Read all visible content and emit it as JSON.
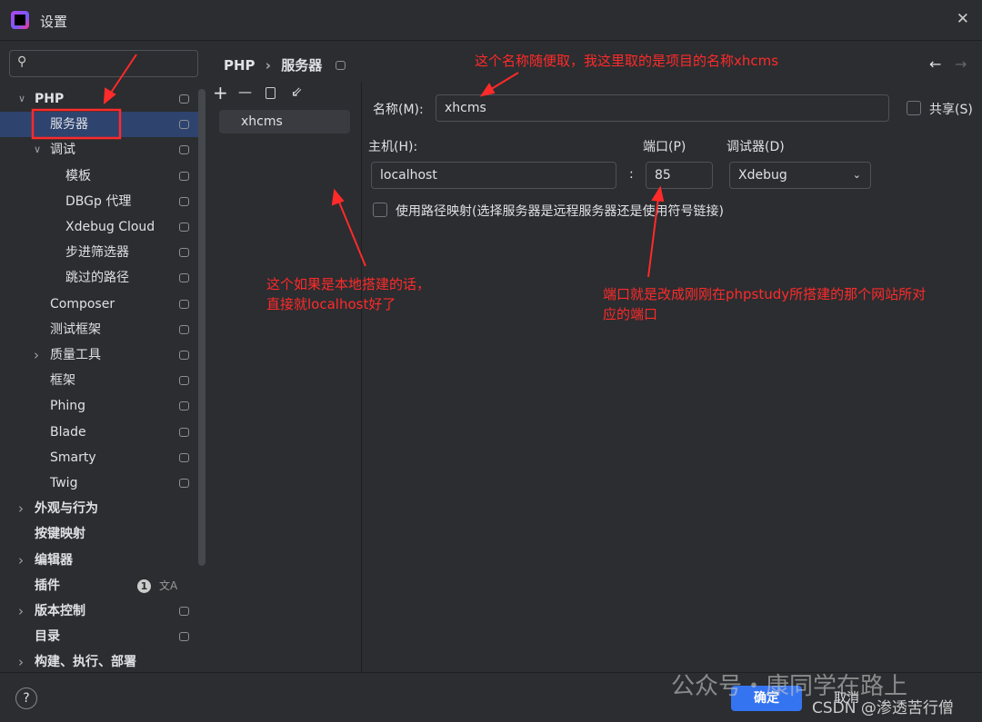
{
  "window": {
    "title": "设置",
    "close": "✕"
  },
  "search": {
    "placeholder": ""
  },
  "breadcrumb": {
    "parent": "PHP",
    "separator": "›",
    "current": "服务器"
  },
  "nav": {
    "back": "←",
    "forward": "→"
  },
  "toolbar": {
    "add": "+",
    "remove": "—",
    "copy": "copy-icon",
    "import": "import-icon"
  },
  "servers": [
    "xhcms"
  ],
  "tree": [
    {
      "label": "PHP",
      "level": 0,
      "expand": "v",
      "bold": true,
      "pin": true
    },
    {
      "label": "服务器",
      "level": 1,
      "selected": true,
      "pin": true
    },
    {
      "label": "调试",
      "level": 1,
      "expand": "v",
      "pin": true
    },
    {
      "label": "模板",
      "level": 2,
      "pin": true
    },
    {
      "label": "DBGp 代理",
      "level": 2,
      "pin": true
    },
    {
      "label": "Xdebug Cloud",
      "level": 2,
      "pin": true
    },
    {
      "label": "步进筛选器",
      "level": 2,
      "pin": true
    },
    {
      "label": "跳过的路径",
      "level": 2,
      "pin": true
    },
    {
      "label": "Composer",
      "level": 1,
      "pin": true
    },
    {
      "label": "测试框架",
      "level": 1,
      "pin": true
    },
    {
      "label": "质量工具",
      "level": 1,
      "expand": ">",
      "pin": true
    },
    {
      "label": "框架",
      "level": 1,
      "pin": true
    },
    {
      "label": "Phing",
      "level": 1,
      "pin": true
    },
    {
      "label": "Blade",
      "level": 1,
      "pin": true
    },
    {
      "label": "Smarty",
      "level": 1,
      "pin": true
    },
    {
      "label": "Twig",
      "level": 1,
      "pin": true
    },
    {
      "label": "外观与行为",
      "level": 0,
      "expand": ">",
      "bold": true
    },
    {
      "label": "按键映射",
      "level": 0,
      "bold": true
    },
    {
      "label": "编辑器",
      "level": 0,
      "expand": ">",
      "bold": true
    },
    {
      "label": "插件",
      "level": 0,
      "bold": true,
      "badge": "1"
    },
    {
      "label": "版本控制",
      "level": 0,
      "expand": ">",
      "bold": true,
      "pin": true
    },
    {
      "label": "目录",
      "level": 0,
      "bold": true,
      "pin": true
    },
    {
      "label": "构建、执行、部署",
      "level": 0,
      "expand": ">",
      "bold": true
    }
  ],
  "form": {
    "name_label": "名称(M):",
    "name_value": "xhcms",
    "share_label": "共享(S)",
    "host_label": "主机(H):",
    "host_value": "localhost",
    "colon": ":",
    "port_label": "端口(P)",
    "port_value": "85",
    "debugger_label": "调试器(D)",
    "debugger_value": "Xdebug",
    "mapping_label": "使用路径映射(选择服务器是远程服务器还是使用符号链接)"
  },
  "annotations": {
    "name": "这个名称随便取，我这里取的是项目的名称xhcms",
    "host1": "这个如果是本地搭建的话，",
    "host2": "直接就localhost好了",
    "port1": "端口就是改成刚刚在phpstudy所搭建的那个网站所对",
    "port2": "应的端口"
  },
  "footer": {
    "help": "?",
    "ok": "确定",
    "cancel": "取消"
  },
  "watermark": {
    "wechat": "公众号・康同学在路上",
    "csdn": "CSDN @渗透苦行僧"
  },
  "colors": {
    "accent": "#3574f0",
    "annotation": "#ff2a2a",
    "selected": "#2e436e"
  }
}
